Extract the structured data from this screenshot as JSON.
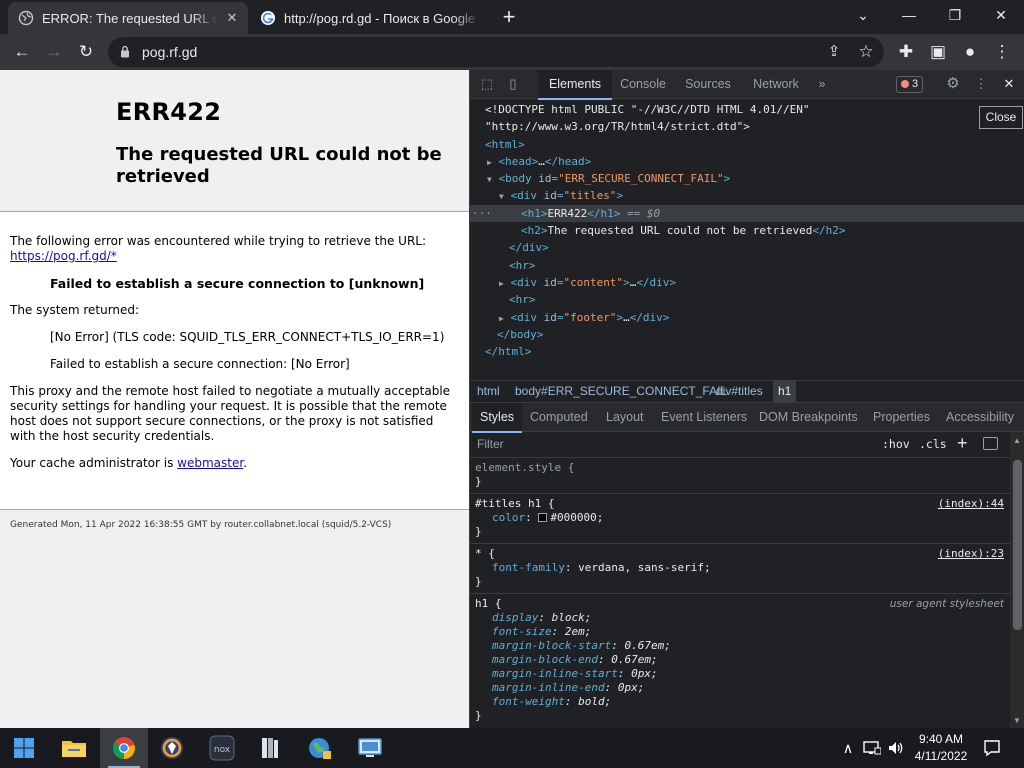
{
  "browser": {
    "tabs": [
      {
        "title": "ERROR: The requested URL could not be retrieved",
        "active": true
      },
      {
        "title": "http://pog.rd.gd - Поиск в Google",
        "active": false
      }
    ],
    "url": "pog.rf.gd"
  },
  "page": {
    "h1": "ERR422",
    "h2": "The requested URL could not be retrieved",
    "intro": "The following error was encountered while trying to retrieve the URL:",
    "link": "https://pog.rf.gd/*",
    "error_strong": "Failed to establish a secure connection to [unknown]",
    "system_returned": "The system returned:",
    "tls_error": "[No Error] (TLS code: SQUID_TLS_ERR_CONNECT+TLS_IO_ERR=1)",
    "secure_fail": "Failed to establish a secure connection: [No Error]",
    "explanation": "This proxy and the remote host failed to negotiate a mutually acceptable security settings for handling your request. It is possible that the remote host does not support secure connections, or the proxy is not satisfied with the host security credentials.",
    "cache_admin_prefix": "Your cache administrator is ",
    "cache_admin_link": "webmaster",
    "cache_admin_suffix": ".",
    "footer": "Generated Mon, 11 Apr 2022 16:38:55 GMT by router.collabnet.local (squid/5.2-VCS)"
  },
  "devtools": {
    "tabs": [
      "Elements",
      "Console",
      "Sources",
      "Network"
    ],
    "more": "»",
    "error_count": "3",
    "close_tooltip": "Close",
    "dom": {
      "doctype1": "<!DOCTYPE html PUBLIC \"-//W3C//DTD HTML 4.01//EN\"",
      "doctype2": "\"http://www.w3.org/TR/html4/strict.dtd\">",
      "html_open": "<html>",
      "head_open": "<head>",
      "head_ellipsis": "…",
      "head_close": "</head>",
      "body_open": "<body",
      "body_attr": "id",
      "body_val": "\"ERR_SECURE_CONNECT_FAIL\"",
      "gt": ">",
      "div_open": "<div",
      "titles_val": "\"titles\"",
      "h1_open": "<h1>",
      "h1_text": "ERR422",
      "h1_close": "</h1>",
      "h1_eq": "== $0",
      "h2_open": "<h2>",
      "h2_text": "The requested URL could not be retrieved",
      "h2_close": "</h2>",
      "div_close": "</div>",
      "hr": "<hr>",
      "content_val": "\"content\"",
      "footer_val": "\"footer\"",
      "div_ellipsis": "…",
      "body_close": "</body>",
      "html_close": "</html>",
      "row_dots": "···"
    },
    "breadcrumbs": [
      "html",
      "body#ERR_SECURE_CONNECT_FAIL",
      "div#titles",
      "h1"
    ],
    "style_tabs": [
      "Styles",
      "Computed",
      "Layout",
      "Event Listeners",
      "DOM Breakpoints",
      "Properties",
      "Accessibility"
    ],
    "filter_placeholder": "Filter",
    "hov": ":hov",
    "cls": ".cls",
    "plus": "+",
    "rules": {
      "element_style": "element.style {",
      "close_brace": "}",
      "titles_selector": "#titles h1 {",
      "titles_source": "(index):44",
      "color_prop": "color",
      "color_val": "#000000;",
      "star_selector": "* {",
      "star_source": "(index):23",
      "font_family_prop": "font-family",
      "font_family_val": "verdana, sans-serif;",
      "h1_selector": "h1 {",
      "h1_source": "user agent stylesheet",
      "ua_decls": [
        {
          "prop": "display",
          "val": "block;"
        },
        {
          "prop": "font-size",
          "val": "2em;"
        },
        {
          "prop": "margin-block-start",
          "val": "0.67em;"
        },
        {
          "prop": "margin-block-end",
          "val": "0.67em;"
        },
        {
          "prop": "margin-inline-start",
          "val": "0px;"
        },
        {
          "prop": "margin-inline-end",
          "val": "0px;"
        },
        {
          "prop": "font-weight",
          "val": "bold;"
        }
      ]
    }
  },
  "taskbar": {
    "time": "9:40 AM",
    "date": "4/11/2022"
  },
  "colors": {
    "accent_blue": "#8ab4f8",
    "error_red": "#f28b82",
    "link": "#1a0dab"
  }
}
